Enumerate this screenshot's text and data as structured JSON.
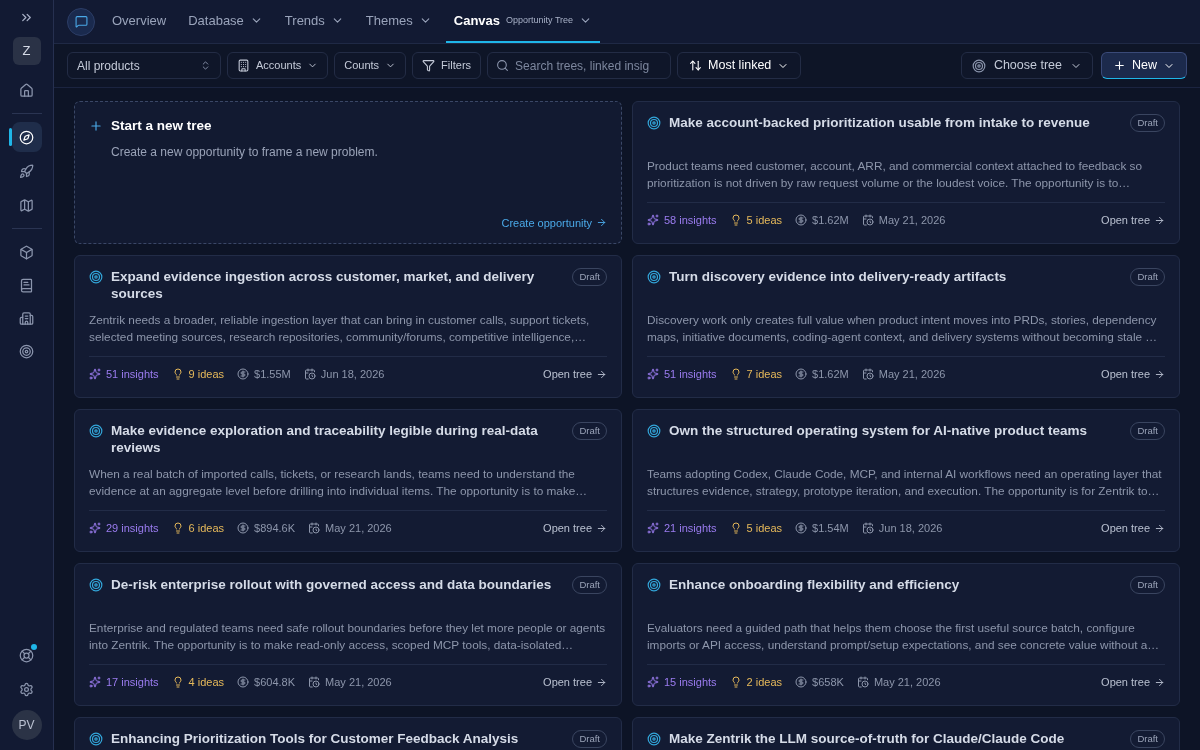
{
  "sidebar": {
    "workspace": "Z",
    "nav": [
      {
        "selected": false
      },
      {
        "selected": true
      },
      {
        "selected": false
      },
      {
        "selected": false
      },
      {
        "selected": false
      },
      {
        "selected": false
      },
      {
        "selected": false
      },
      {
        "selected": false
      }
    ],
    "help_notification": true,
    "avatar": "PV"
  },
  "tabs": [
    {
      "label": "Overview",
      "selected": false,
      "menu": false
    },
    {
      "label": "Database",
      "selected": false,
      "menu": true
    },
    {
      "label": "Trends",
      "selected": false,
      "menu": true
    },
    {
      "label": "Themes",
      "selected": false,
      "menu": true
    },
    {
      "label": "Canvas",
      "subtitle": "Opportunity Tree",
      "selected": true,
      "menu": true
    }
  ],
  "toolbar": {
    "product": "All products",
    "accounts": "Accounts",
    "counts": "Counts",
    "filters": "Filters",
    "search": {
      "placeholder": "Search trees, linked insig"
    },
    "sort": "Most linked",
    "choose_tree": "Choose tree",
    "new": "New"
  },
  "cards": [
    {
      "kind": "new",
      "title": "Start a new tree",
      "description": "Create a new opportunity to frame a new problem.",
      "action": "Create opportunity"
    },
    {
      "kind": "tree",
      "title": "Make account-backed prioritization usable from intake to revenue",
      "status": "Draft",
      "description": "Product teams need customer, account, ARR, and commercial context attached to feedback so prioritization is not driven by raw request volume or the loudest voice. The opportunity is to…",
      "insights": "58 insights",
      "ideas": "5 ideas",
      "value": "$1.62M",
      "date": "May 21, 2026",
      "action": "Open tree"
    },
    {
      "kind": "tree",
      "title": "Expand evidence ingestion across customer, market, and delivery sources",
      "status": "Draft",
      "description": "Zentrik needs a broader, reliable ingestion layer that can bring in customer calls, support tickets, selected meeting sources, research repositories, community/forums, competitive intelligence,…",
      "insights": "51 insights",
      "ideas": "9 ideas",
      "value": "$1.55M",
      "date": "Jun 18, 2026",
      "action": "Open tree"
    },
    {
      "kind": "tree",
      "title": "Turn discovery evidence into delivery-ready artifacts",
      "status": "Draft",
      "description": "Discovery work only creates full value when product intent moves into PRDs, stories, dependency maps, initiative documents, coding-agent context, and delivery systems without becoming stale …",
      "insights": "51 insights",
      "ideas": "7 ideas",
      "value": "$1.62M",
      "date": "May 21, 2026",
      "action": "Open tree"
    },
    {
      "kind": "tree",
      "title": "Make evidence exploration and traceability legible during real-data reviews",
      "status": "Draft",
      "description": "When a real batch of imported calls, tickets, or research lands, teams need to understand the evidence at an aggregate level before drilling into individual items. The opportunity is to make…",
      "insights": "29 insights",
      "ideas": "6 ideas",
      "value": "$894.6K",
      "date": "May 21, 2026",
      "action": "Open tree"
    },
    {
      "kind": "tree",
      "title": "Own the structured operating system for AI-native product teams",
      "status": "Draft",
      "description": "Teams adopting Codex, Claude Code, MCP, and internal AI workflows need an operating layer that structures evidence, strategy, prototype iteration, and execution. The opportunity is for Zentrik to…",
      "insights": "21 insights",
      "ideas": "5 ideas",
      "value": "$1.54M",
      "date": "Jun 18, 2026",
      "action": "Open tree"
    },
    {
      "kind": "tree",
      "title": "De-risk enterprise rollout with governed access and data boundaries",
      "status": "Draft",
      "description": "Enterprise and regulated teams need safe rollout boundaries before they let more people or agents into Zentrik. The opportunity is to make read-only access, scoped MCP tools, data-isolated…",
      "insights": "17 insights",
      "ideas": "4 ideas",
      "value": "$604.8K",
      "date": "May 21, 2026",
      "action": "Open tree"
    },
    {
      "kind": "tree",
      "title": "Enhance onboarding flexibility and efficiency",
      "status": "Draft",
      "description": "Evaluators need a guided path that helps them choose the first useful source batch, configure imports or API access, understand prompt/setup expectations, and see concrete value without a…",
      "insights": "15 insights",
      "ideas": "2 ideas",
      "value": "$658K",
      "date": "May 21, 2026",
      "action": "Open tree"
    },
    {
      "kind": "tree",
      "title": "Enhancing Prioritization Tools for Customer Feedback Analysis",
      "status": "Draft"
    },
    {
      "kind": "tree",
      "title": "Make Zentrik the LLM source-of-truth for Claude/Claude Code",
      "status": "Draft"
    }
  ]
}
